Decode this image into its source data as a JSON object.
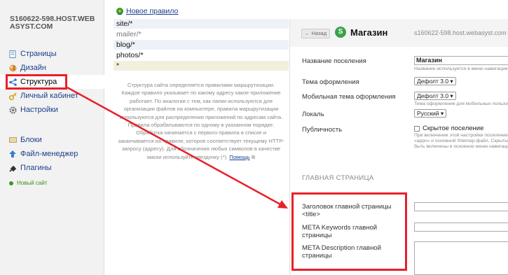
{
  "sidebar": {
    "site_title": "S160622-598.HOST.WEBASYST.COM",
    "items": [
      {
        "label": "Страницы",
        "icon": "pages-icon"
      },
      {
        "label": "Дизайн",
        "icon": "design-icon"
      },
      {
        "label": "Структура",
        "icon": "structure-icon"
      },
      {
        "label": "Личный кабинет",
        "icon": "key-icon"
      },
      {
        "label": "Настройки",
        "icon": "settings-icon"
      }
    ],
    "items2": [
      {
        "label": "Блоки",
        "icon": "blocks-icon"
      },
      {
        "label": "Файл-менеджер",
        "icon": "upload-icon"
      },
      {
        "label": "Плагины",
        "icon": "plugins-icon"
      }
    ],
    "new_site": "Новый сайт"
  },
  "routes": {
    "new_rule": "Новое правило",
    "items": [
      "site/*",
      "mailer/*",
      "blog/*",
      "photos/*",
      "*"
    ],
    "help_text": "Структура сайта определяется правилами маршрутизации. Каждое правило указывает по какому адресу какое приложение работает. По аналогии с тем, как папки используются для организации файлов на компьютере, правила маршрутизации используются для распределения приложений по адресам сайта. Правила обрабатываются по одному в указанном порядке. Обработка начинается с первого правила в списке и заканчивается на правиле, которое соответствует текущему HTTP-запросу (адресу). Для обозначения любых символов в качестве маски используйте звездочку (*).",
    "help_link": "Помощь"
  },
  "settings": {
    "back_label": "← Назад",
    "app_icon_letter": "S",
    "app_title": "Магазин",
    "host": "s160622-598.host.webasyst.com",
    "fields": {
      "settlement_name_label": "Название поселения",
      "settlement_name_value": "Магазин",
      "settlement_name_hint": "Название используется в меню навигации",
      "theme_label": "Тема оформления",
      "theme_value": "Дефолт 3.0 ▾",
      "mobile_theme_label": "Мобильная тема оформления",
      "mobile_theme_value": "Дефолт 3.0 ▾",
      "mobile_theme_hint": "Тема оформления для мобильных пользователей",
      "locale_label": "Локаль",
      "locale_value": "Русский ▾",
      "publicity_label": "Публичность",
      "hidden_label": "Скрытое поселение",
      "hidden_hint_1": "При включении этой настройки поселение",
      "hidden_hint_2": "«apps» и основной Sitemap-файл. Скрытые",
      "hidden_hint_3": "быть включены в основное меню навигации"
    },
    "main_page_section": "ГЛАВНАЯ СТРАНИЦА",
    "main_title_label": "Заголовок главной страницы <title>",
    "meta_keywords_label": "META Keywords главной страницы",
    "meta_description_label": "META Description главной страницы"
  },
  "colors": {
    "highlight": "#e8202a",
    "link": "#1a3f8c",
    "accent_green": "#3aa14a"
  }
}
